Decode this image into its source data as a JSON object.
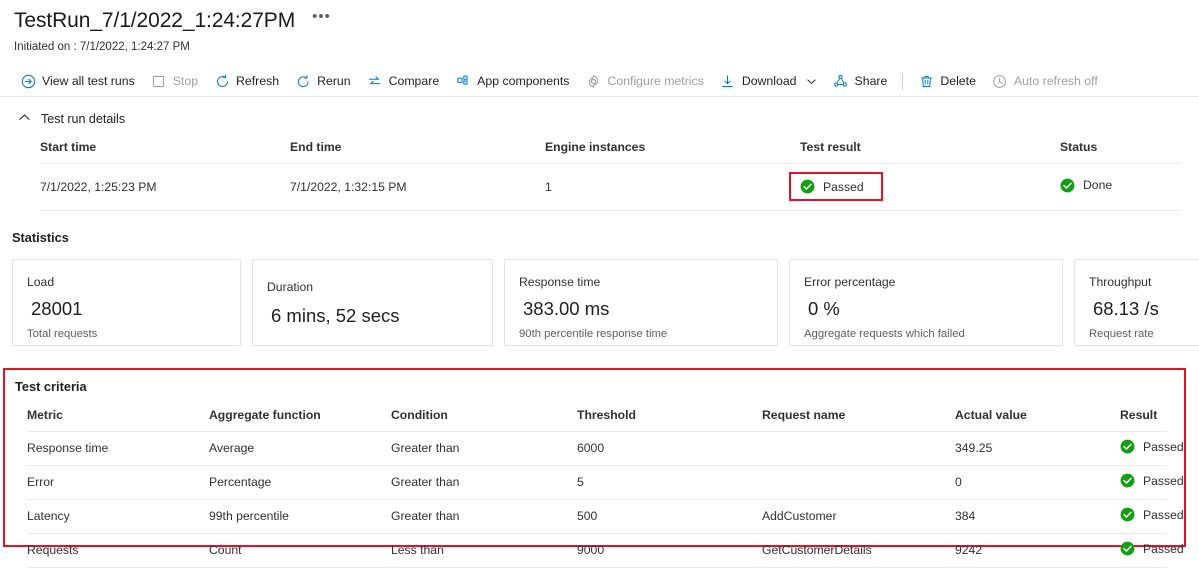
{
  "header": {
    "title": "TestRun_7/1/2022_1:24:27PM",
    "more_label": "•••",
    "subtitle": "Initiated on : 7/1/2022, 1:24:27 PM"
  },
  "toolbar": {
    "items": [
      {
        "label": "View all test runs",
        "icon": "arrow-circle-right-icon",
        "disabled": false
      },
      {
        "label": "Stop",
        "icon": "stop-square-icon",
        "disabled": true
      },
      {
        "label": "Refresh",
        "icon": "refresh-icon",
        "disabled": false
      },
      {
        "label": "Rerun",
        "icon": "rerun-icon",
        "disabled": false
      },
      {
        "label": "Compare",
        "icon": "compare-arrows-icon",
        "disabled": false
      },
      {
        "label": "App components",
        "icon": "app-components-icon",
        "disabled": false
      },
      {
        "label": "Configure metrics",
        "icon": "gear-icon",
        "disabled": true
      },
      {
        "label": "Download",
        "icon": "download-icon",
        "disabled": false,
        "chevron": true
      },
      {
        "label": "Share",
        "icon": "share-icon",
        "disabled": false
      },
      {
        "label": "Delete",
        "icon": "trash-icon",
        "disabled": false
      },
      {
        "label": "Auto refresh off",
        "icon": "clock-icon",
        "disabled": true
      }
    ]
  },
  "details_section": {
    "toggle_label": "Test run details",
    "chevron_icon": "chevron-up-icon",
    "columns": [
      "Start time",
      "End time",
      "Engine instances",
      "Test result",
      "Status"
    ],
    "row": {
      "start_time": "7/1/2022, 1:25:23 PM",
      "end_time": "7/1/2022, 1:32:15 PM",
      "engine_instances": "1",
      "test_result": "Passed",
      "status": "Done"
    }
  },
  "statistics": {
    "heading": "Statistics",
    "cards": [
      {
        "label": "Load",
        "value": "28001",
        "sub": "Total requests"
      },
      {
        "label": "Duration",
        "value": "6 mins, 52 secs",
        "sub": ""
      },
      {
        "label": "Response time",
        "value": "383.00 ms",
        "sub": "90th percentile response time"
      },
      {
        "label": "Error percentage",
        "value": "0 %",
        "sub": "Aggregate requests which failed"
      },
      {
        "label": "Throughput",
        "value": "68.13 /s",
        "sub": "Request rate"
      }
    ]
  },
  "criteria": {
    "title": "Test criteria",
    "columns": [
      "Metric",
      "Aggregate function",
      "Condition",
      "Threshold",
      "Request name",
      "Actual value",
      "Result"
    ],
    "rows": [
      {
        "metric": "Response time",
        "aggregate": "Average",
        "condition": "Greater than",
        "threshold": "6000",
        "request": "",
        "actual": "349.25",
        "result": "Passed"
      },
      {
        "metric": "Error",
        "aggregate": "Percentage",
        "condition": "Greater than",
        "threshold": "5",
        "request": "",
        "actual": "0",
        "result": "Passed"
      },
      {
        "metric": "Latency",
        "aggregate": "99th percentile",
        "condition": "Greater than",
        "threshold": "500",
        "request": "AddCustomer",
        "actual": "384",
        "result": "Passed"
      },
      {
        "metric": "Requests",
        "aggregate": "Count",
        "condition": "Less than",
        "threshold": "9000",
        "request": "GetCustomerDetails",
        "actual": "9242",
        "result": "Passed"
      }
    ]
  },
  "colors": {
    "accent_blue": "#0078d4",
    "success_green": "#107c10",
    "highlight_red": "#e81123",
    "disabled_gray": "#a19f9d"
  }
}
